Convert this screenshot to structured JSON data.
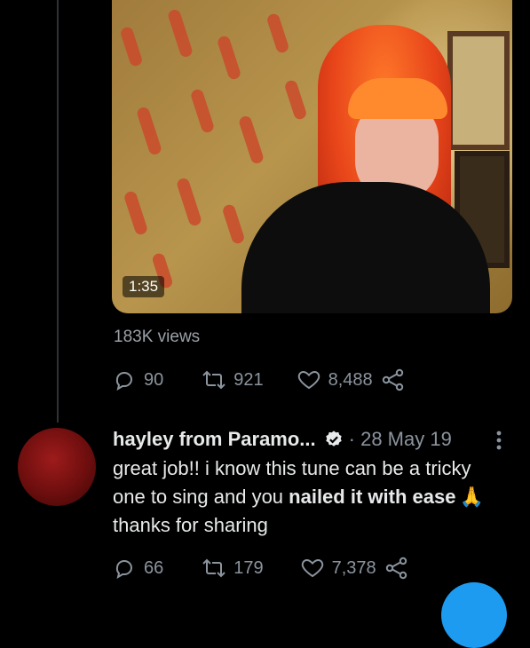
{
  "video": {
    "duration": "1:35",
    "views": "183K views"
  },
  "tweet_actions": {
    "replies": "90",
    "retweets": "921",
    "likes": "8,488"
  },
  "reply": {
    "display_name": "hayley from Paramo...",
    "verified": true,
    "meta": "· 28 May 19",
    "text_part1": "great job!! i know this tune can be a tricky one to sing and you ",
    "text_bold": "nailed it with ease",
    "emoji": "🙏",
    "text_part2": "thanks for sharing",
    "actions": {
      "replies": "66",
      "retweets": "179",
      "likes": "7,378"
    }
  },
  "colors": {
    "background": "#000000",
    "muted": "#8b949e",
    "accent": "#1d9bf0"
  },
  "icons": [
    "reply-icon",
    "retweet-icon",
    "like-icon",
    "share-icon",
    "verified-badge-icon",
    "more-icon"
  ]
}
